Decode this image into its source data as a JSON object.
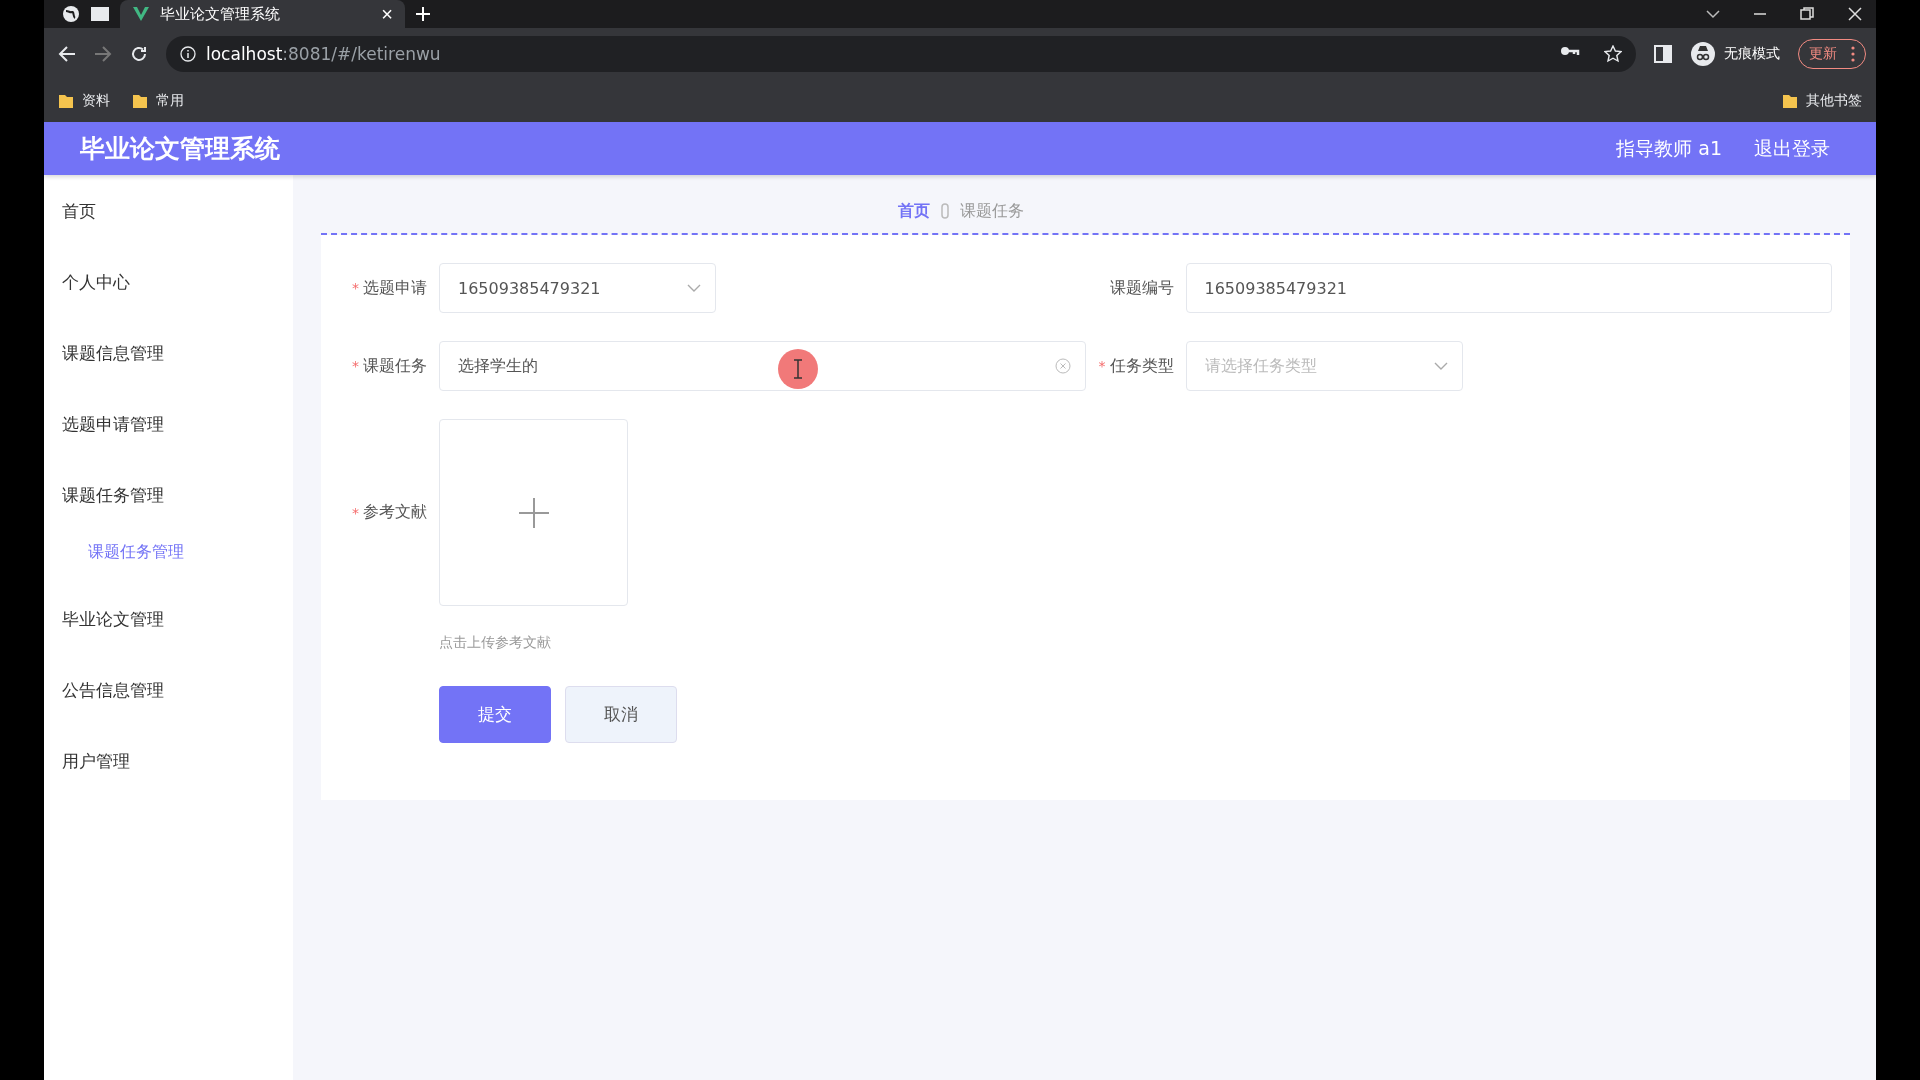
{
  "browser": {
    "tab": {
      "title": "毕业论文管理系统",
      "close": "×"
    },
    "url": {
      "host": "localhost",
      "path": ":8081/#/ketirenwu"
    },
    "profile": "无痕模式",
    "update": "更新",
    "bookmarks": [
      {
        "label": "资料"
      },
      {
        "label": "常用"
      }
    ],
    "other_bookmarks": "其他书签"
  },
  "header": {
    "title": "毕业论文管理系统",
    "user": "指导教师 a1",
    "logout": "退出登录"
  },
  "sidebar": {
    "items": [
      {
        "label": "首页",
        "selected": false
      },
      {
        "label": "个人中心",
        "selected": false
      },
      {
        "label": "课题信息管理",
        "selected": false
      },
      {
        "label": "选题申请管理",
        "selected": false
      },
      {
        "label": "课题任务管理",
        "selected": false,
        "children": [
          {
            "label": "课题任务管理",
            "selected": true
          }
        ]
      },
      {
        "label": "毕业论文管理",
        "selected": false
      },
      {
        "label": "公告信息管理",
        "selected": false
      },
      {
        "label": "用户管理",
        "selected": false
      }
    ]
  },
  "breadcrumb": [
    "首页",
    "课题任务"
  ],
  "form": {
    "rows": [
      [
        {
          "kind": "select",
          "marker": "*",
          "label": "选题申请",
          "value": "16509385479321"
        },
        {
          "kind": "text",
          "label": "课题编号",
          "value": "16509385479321"
        }
      ],
      [
        {
          "kind": "text",
          "marker": "*",
          "label": "课题任务",
          "value": "选择学生的",
          "clearable": true
        },
        {
          "kind": "select",
          "marker": "*",
          "label": "任务类型",
          "placeholder": "请选择任务类型"
        }
      ],
      [
        {
          "kind": "upload",
          "marker": "*",
          "label": "参考文献",
          "hint": "点击上传参考文献"
        }
      ]
    ],
    "buttons": [
      {
        "label": "提交",
        "kind": "primary"
      },
      {
        "label": "取消",
        "kind": "default"
      }
    ]
  }
}
